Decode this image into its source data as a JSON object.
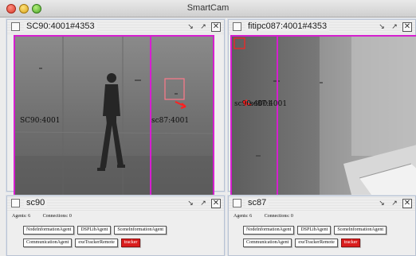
{
  "app": {
    "title": "SmartCam"
  },
  "colors": {
    "overlay_border": "#d61fd0",
    "tracker_button": "#d91d1d"
  },
  "camera_views": [
    {
      "title": "SC90:4001#4353",
      "overlay_labels": [
        "SC90:4001",
        "sc87:4001"
      ]
    },
    {
      "title": "fitipc087:4001#4353",
      "overlay_labels": [
        "sc90:4001",
        "sc87:4001"
      ]
    }
  ],
  "agent_panels": [
    {
      "title": "sc90",
      "agents_label": "Agents: 6",
      "connections_label": "Connections: 0",
      "buttons_row1": [
        "NodeInformationAgent",
        "DSPLibAgent",
        "SceneInformationAgent"
      ],
      "buttons_row2": [
        "CommunicationAgent",
        "exeTrackerRemote",
        "tracker"
      ]
    },
    {
      "title": "sc87",
      "agents_label": "Agents: 6",
      "connections_label": "Connections: 0",
      "buttons_row1": [
        "NodeInformationAgent",
        "DSPLibAgent",
        "SceneInformationAgent"
      ],
      "buttons_row2": [
        "CommunicationAgent",
        "exeTrackerRemote",
        "tracker"
      ]
    }
  ],
  "icons": [
    "window-close-red",
    "window-minimize-yellow",
    "window-zoom-green",
    "frame-menu-icon",
    "iconify-icon",
    "maximize-icon",
    "close-icon"
  ]
}
